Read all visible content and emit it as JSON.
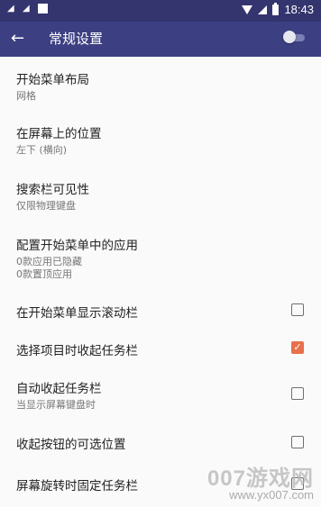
{
  "statusbar": {
    "time": "18:43",
    "left_icons": [
      "notification-icon",
      "notification-icon",
      "square-icon"
    ],
    "right_icons": [
      "wifi-icon",
      "signal-icon",
      "battery-icon"
    ]
  },
  "appbar": {
    "back": "←",
    "title": "常规设置",
    "toggle_on": false
  },
  "settings": [
    {
      "title": "开始菜单布局",
      "subtitle": "网格"
    },
    {
      "title": "在屏幕上的位置",
      "subtitle": "左下 (横向)"
    },
    {
      "title": "搜索栏可见性",
      "subtitle": "仅限物理键盘"
    },
    {
      "title": "配置开始菜单中的应用",
      "subtitle": "0款应用已隐藏",
      "subtitle2": "0款置顶应用"
    },
    {
      "title": "在开始菜单显示滚动栏",
      "checked": false
    },
    {
      "title": "选择项目时收起任务栏",
      "checked": true
    },
    {
      "title": "自动收起任务栏",
      "subtitle": "当显示屏幕键盘时",
      "checked": false
    },
    {
      "title": "收起按钮的可选位置",
      "checked": false
    },
    {
      "title": "屏幕旋转时固定任务栏",
      "checked": false
    }
  ],
  "watermark": {
    "line1": "007游戏网",
    "line2": "www.yx007.com"
  },
  "colors": {
    "status_bar": "#34346f",
    "app_bar": "#3c3f82",
    "accent": "#e8704c"
  }
}
